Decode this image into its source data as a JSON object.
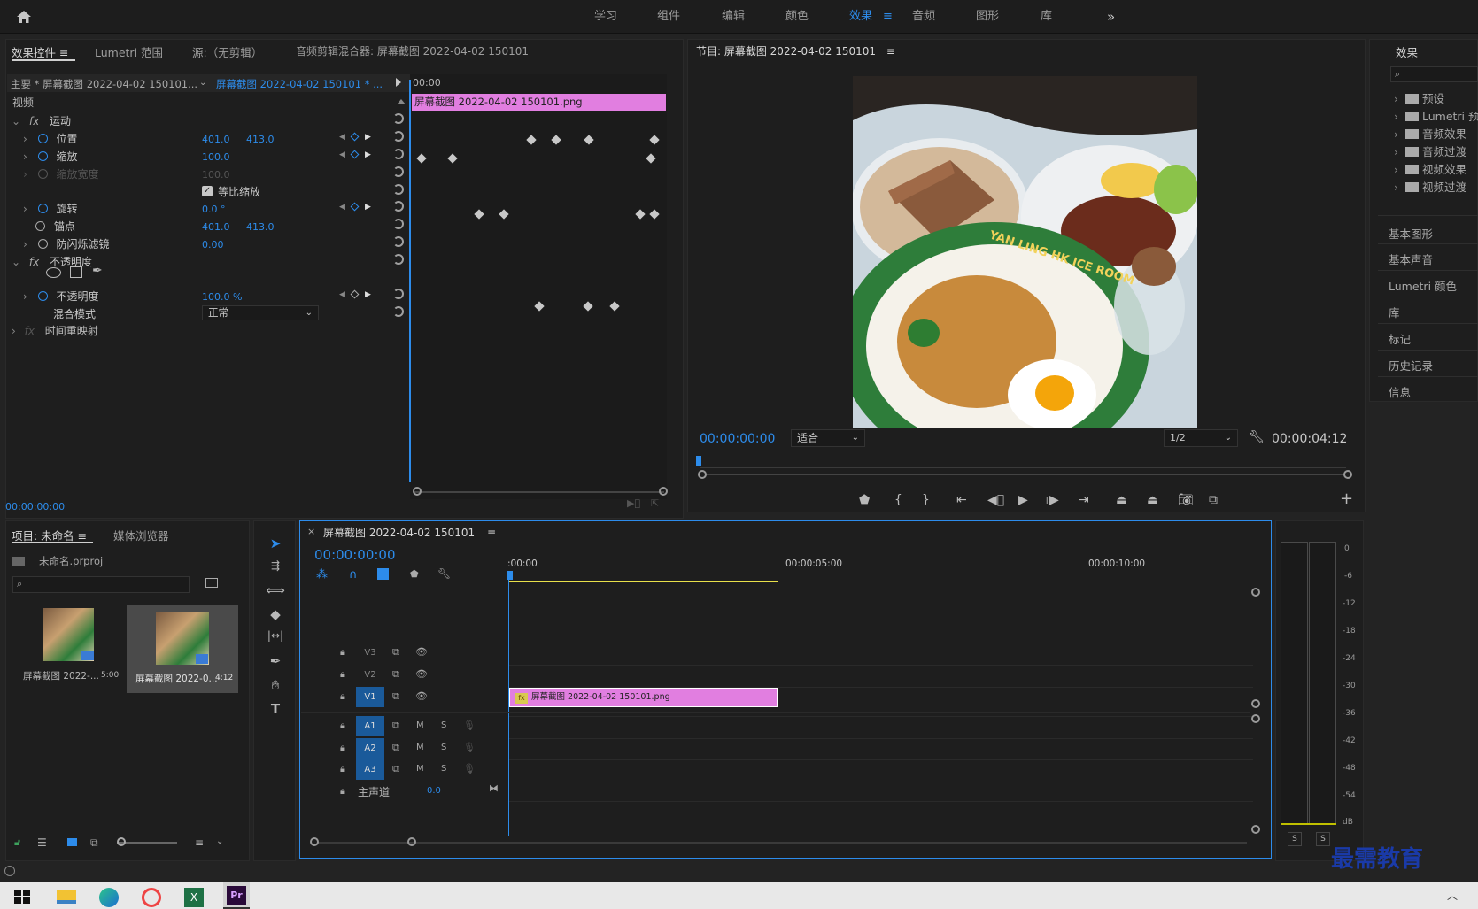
{
  "workspaces": [
    "学习",
    "组件",
    "编辑",
    "颜色",
    "效果",
    "音频",
    "图形",
    "库"
  ],
  "active_workspace": "效果",
  "effect_controls": {
    "tabs": [
      "效果控件",
      "Lumetri 范围",
      "源:（无剪辑）",
      "音频剪辑混合器: 屏幕截图 2022-04-02 150101"
    ],
    "master": "主要 * 屏幕截图 2022-04-02 150101...",
    "clip": "屏幕截图 2022-04-02 150101 * ...",
    "ruler_time": "00:00",
    "clip_bar": "屏幕截图 2022-04-02  150101.png",
    "section_video": "视频",
    "motion": "运动",
    "position_label": "位置",
    "position_x": "401.0",
    "position_y": "413.0",
    "scale_label": "缩放",
    "scale_val": "100.0",
    "scale_width_label": "缩放宽度",
    "scale_width_val": "100.0",
    "uniform_label": "等比缩放",
    "rotation_label": "旋转",
    "rotation_val": "0.0 °",
    "anchor_label": "锚点",
    "anchor_x": "401.0",
    "anchor_y": "413.0",
    "flicker_label": "防闪烁滤镜",
    "flicker_val": "0.00",
    "opacity_section": "不透明度",
    "opacity_label": "不透明度",
    "opacity_val": "100.0 %",
    "blend_label": "混合模式",
    "blend_val": "正常",
    "time_remap": "时间重映射",
    "timecode": "00:00:00:00"
  },
  "program": {
    "title": "节目: 屏幕截图 2022-04-02 150101",
    "timecode": "00:00:00:00",
    "fit": "适合",
    "resolution": "1/2",
    "duration": "00:00:04:12",
    "image_text": "YAN LING HK ICE ROOM"
  },
  "effects_panel": {
    "title": "效果",
    "folders": [
      "预设",
      "Lumetri 预设",
      "音频效果",
      "音频过渡",
      "视频效果",
      "视频过渡"
    ],
    "panels": [
      "基本图形",
      "基本声音",
      "Lumetri 颜色",
      "库",
      "标记",
      "历史记录",
      "信息"
    ]
  },
  "project": {
    "tabs": [
      "项目: 未命名",
      "媒体浏览器"
    ],
    "file": "未命名.prproj",
    "items": [
      {
        "name": "屏幕截图 2022-...",
        "duration": "5:00"
      },
      {
        "name": "屏幕截图 2022-0...",
        "duration": "4:12"
      }
    ]
  },
  "timeline": {
    "title": "屏幕截图 2022-04-02 150101",
    "timecode": "00:00:00:00",
    "ruler": [
      ":00:00",
      "00:00:05:00",
      "00:00:10:00"
    ],
    "tracks_video": [
      "V3",
      "V2",
      "V1"
    ],
    "tracks_audio": [
      "A1",
      "A2",
      "A3"
    ],
    "master_label": "主声道",
    "master_val": "0.0",
    "clip": "屏幕截图 2022-04-02  150101.png",
    "m": "M",
    "s": "S"
  },
  "meter": {
    "labels": [
      "0",
      "-6",
      "-12",
      "-18",
      "-24",
      "-30",
      "-36",
      "-42",
      "-48",
      "-54",
      "dB"
    ],
    "solo": [
      "S",
      "S"
    ]
  },
  "watermark": "最需教育"
}
